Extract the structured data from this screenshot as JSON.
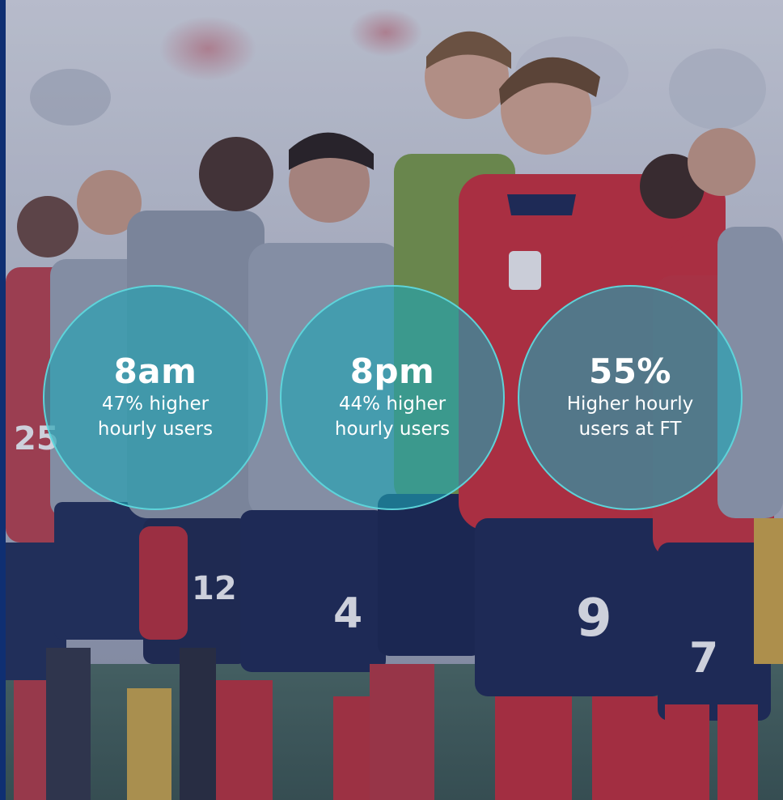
{
  "stats": [
    {
      "headline": "8am",
      "caption": "47% higher hourly users"
    },
    {
      "headline": "8pm",
      "caption": "44% higher hourly users"
    },
    {
      "headline": "55%",
      "caption": "Higher hourly users at FT"
    }
  ],
  "colors": {
    "accent_bar": "#0f2f72",
    "circle_fill": "#1ea5b4",
    "circle_border": "#5fd7dc",
    "shirt_red": "#c8303c",
    "shorts_navy": "#1f2a55",
    "kit_grey": "#9aa3b2",
    "text": "#ffffff"
  },
  "background": {
    "subject": "photo of footballers in red, grey and green kits standing on a pitch"
  }
}
